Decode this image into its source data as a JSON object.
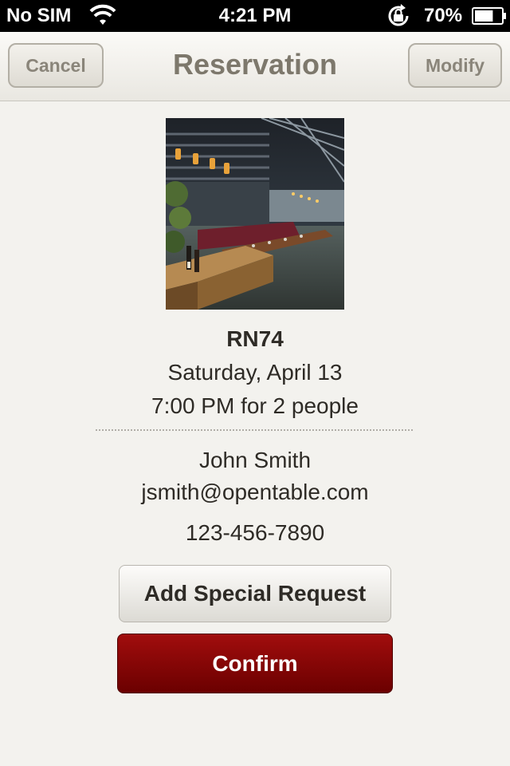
{
  "status_bar": {
    "carrier": "No SIM",
    "time": "4:21 PM",
    "battery": "70%",
    "battery_level": 0.7
  },
  "nav": {
    "title": "Reservation",
    "cancel_label": "Cancel",
    "modify_label": "Modify"
  },
  "reservation": {
    "restaurant": "RN74",
    "date": "Saturday, April 13",
    "time_party": "7:00 PM for 2 people"
  },
  "guest": {
    "name": "John Smith",
    "email": "jsmith@opentable.com",
    "phone": "123-456-7890"
  },
  "actions": {
    "special_request_label": "Add Special Request",
    "confirm_label": "Confirm"
  },
  "colors": {
    "confirm": "#8b0000",
    "background": "#f3f2ee",
    "nav_title": "#7d786c"
  },
  "icons": [
    "wifi-icon",
    "lock-rotation-icon",
    "battery-icon"
  ]
}
